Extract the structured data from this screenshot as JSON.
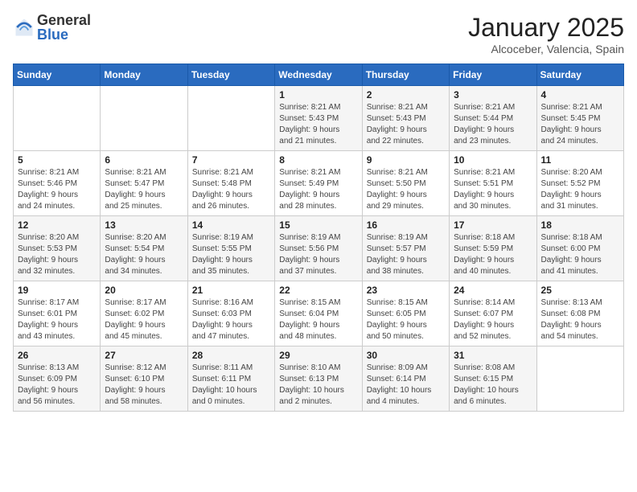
{
  "logo": {
    "general": "General",
    "blue": "Blue"
  },
  "title": "January 2025",
  "subtitle": "Alcoceber, Valencia, Spain",
  "days_of_week": [
    "Sunday",
    "Monday",
    "Tuesday",
    "Wednesday",
    "Thursday",
    "Friday",
    "Saturday"
  ],
  "weeks": [
    [
      {
        "day": "",
        "content": ""
      },
      {
        "day": "",
        "content": ""
      },
      {
        "day": "",
        "content": ""
      },
      {
        "day": "1",
        "content": "Sunrise: 8:21 AM\nSunset: 5:43 PM\nDaylight: 9 hours\nand 21 minutes."
      },
      {
        "day": "2",
        "content": "Sunrise: 8:21 AM\nSunset: 5:43 PM\nDaylight: 9 hours\nand 22 minutes."
      },
      {
        "day": "3",
        "content": "Sunrise: 8:21 AM\nSunset: 5:44 PM\nDaylight: 9 hours\nand 23 minutes."
      },
      {
        "day": "4",
        "content": "Sunrise: 8:21 AM\nSunset: 5:45 PM\nDaylight: 9 hours\nand 24 minutes."
      }
    ],
    [
      {
        "day": "5",
        "content": "Sunrise: 8:21 AM\nSunset: 5:46 PM\nDaylight: 9 hours\nand 24 minutes."
      },
      {
        "day": "6",
        "content": "Sunrise: 8:21 AM\nSunset: 5:47 PM\nDaylight: 9 hours\nand 25 minutes."
      },
      {
        "day": "7",
        "content": "Sunrise: 8:21 AM\nSunset: 5:48 PM\nDaylight: 9 hours\nand 26 minutes."
      },
      {
        "day": "8",
        "content": "Sunrise: 8:21 AM\nSunset: 5:49 PM\nDaylight: 9 hours\nand 28 minutes."
      },
      {
        "day": "9",
        "content": "Sunrise: 8:21 AM\nSunset: 5:50 PM\nDaylight: 9 hours\nand 29 minutes."
      },
      {
        "day": "10",
        "content": "Sunrise: 8:21 AM\nSunset: 5:51 PM\nDaylight: 9 hours\nand 30 minutes."
      },
      {
        "day": "11",
        "content": "Sunrise: 8:20 AM\nSunset: 5:52 PM\nDaylight: 9 hours\nand 31 minutes."
      }
    ],
    [
      {
        "day": "12",
        "content": "Sunrise: 8:20 AM\nSunset: 5:53 PM\nDaylight: 9 hours\nand 32 minutes."
      },
      {
        "day": "13",
        "content": "Sunrise: 8:20 AM\nSunset: 5:54 PM\nDaylight: 9 hours\nand 34 minutes."
      },
      {
        "day": "14",
        "content": "Sunrise: 8:19 AM\nSunset: 5:55 PM\nDaylight: 9 hours\nand 35 minutes."
      },
      {
        "day": "15",
        "content": "Sunrise: 8:19 AM\nSunset: 5:56 PM\nDaylight: 9 hours\nand 37 minutes."
      },
      {
        "day": "16",
        "content": "Sunrise: 8:19 AM\nSunset: 5:57 PM\nDaylight: 9 hours\nand 38 minutes."
      },
      {
        "day": "17",
        "content": "Sunrise: 8:18 AM\nSunset: 5:59 PM\nDaylight: 9 hours\nand 40 minutes."
      },
      {
        "day": "18",
        "content": "Sunrise: 8:18 AM\nSunset: 6:00 PM\nDaylight: 9 hours\nand 41 minutes."
      }
    ],
    [
      {
        "day": "19",
        "content": "Sunrise: 8:17 AM\nSunset: 6:01 PM\nDaylight: 9 hours\nand 43 minutes."
      },
      {
        "day": "20",
        "content": "Sunrise: 8:17 AM\nSunset: 6:02 PM\nDaylight: 9 hours\nand 45 minutes."
      },
      {
        "day": "21",
        "content": "Sunrise: 8:16 AM\nSunset: 6:03 PM\nDaylight: 9 hours\nand 47 minutes."
      },
      {
        "day": "22",
        "content": "Sunrise: 8:15 AM\nSunset: 6:04 PM\nDaylight: 9 hours\nand 48 minutes."
      },
      {
        "day": "23",
        "content": "Sunrise: 8:15 AM\nSunset: 6:05 PM\nDaylight: 9 hours\nand 50 minutes."
      },
      {
        "day": "24",
        "content": "Sunrise: 8:14 AM\nSunset: 6:07 PM\nDaylight: 9 hours\nand 52 minutes."
      },
      {
        "day": "25",
        "content": "Sunrise: 8:13 AM\nSunset: 6:08 PM\nDaylight: 9 hours\nand 54 minutes."
      }
    ],
    [
      {
        "day": "26",
        "content": "Sunrise: 8:13 AM\nSunset: 6:09 PM\nDaylight: 9 hours\nand 56 minutes."
      },
      {
        "day": "27",
        "content": "Sunrise: 8:12 AM\nSunset: 6:10 PM\nDaylight: 9 hours\nand 58 minutes."
      },
      {
        "day": "28",
        "content": "Sunrise: 8:11 AM\nSunset: 6:11 PM\nDaylight: 10 hours\nand 0 minutes."
      },
      {
        "day": "29",
        "content": "Sunrise: 8:10 AM\nSunset: 6:13 PM\nDaylight: 10 hours\nand 2 minutes."
      },
      {
        "day": "30",
        "content": "Sunrise: 8:09 AM\nSunset: 6:14 PM\nDaylight: 10 hours\nand 4 minutes."
      },
      {
        "day": "31",
        "content": "Sunrise: 8:08 AM\nSunset: 6:15 PM\nDaylight: 10 hours\nand 6 minutes."
      },
      {
        "day": "",
        "content": ""
      }
    ]
  ]
}
